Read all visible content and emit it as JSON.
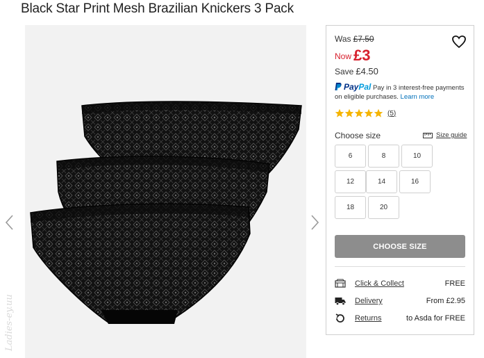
{
  "product": {
    "title": "Black Star Print Mesh Brazilian Knickers 3 Pack"
  },
  "gallery": {
    "watermark": "Ladies-ey.uu"
  },
  "pricing": {
    "was_label": "Was",
    "was_price": "£7.50",
    "now_label": "Now",
    "now_price": "£3",
    "save_label": "Save",
    "save_amount": "£4.50",
    "accent_color": "#d7202d"
  },
  "paypal": {
    "logo_pay": "Pay",
    "logo_pal": "Pal",
    "text": "Pay in 3 interest-free payments on eligible purchases.",
    "link": "Learn more"
  },
  "rating": {
    "stars": 5,
    "count": "(5)",
    "star_color": "#f5b400"
  },
  "sizes": {
    "label": "Choose size",
    "guide_label": "Size guide",
    "options": [
      "6",
      "8",
      "10",
      "12",
      "14",
      "16",
      "18",
      "20"
    ]
  },
  "cta": {
    "label": "CHOOSE SIZE"
  },
  "delivery": [
    {
      "icon": "store-icon",
      "label": "Click & Collect",
      "value": "FREE"
    },
    {
      "icon": "truck-icon",
      "label": "Delivery",
      "value": "From £2.95"
    },
    {
      "icon": "returns-icon",
      "label": "Returns",
      "value": "to Asda for FREE"
    }
  ]
}
